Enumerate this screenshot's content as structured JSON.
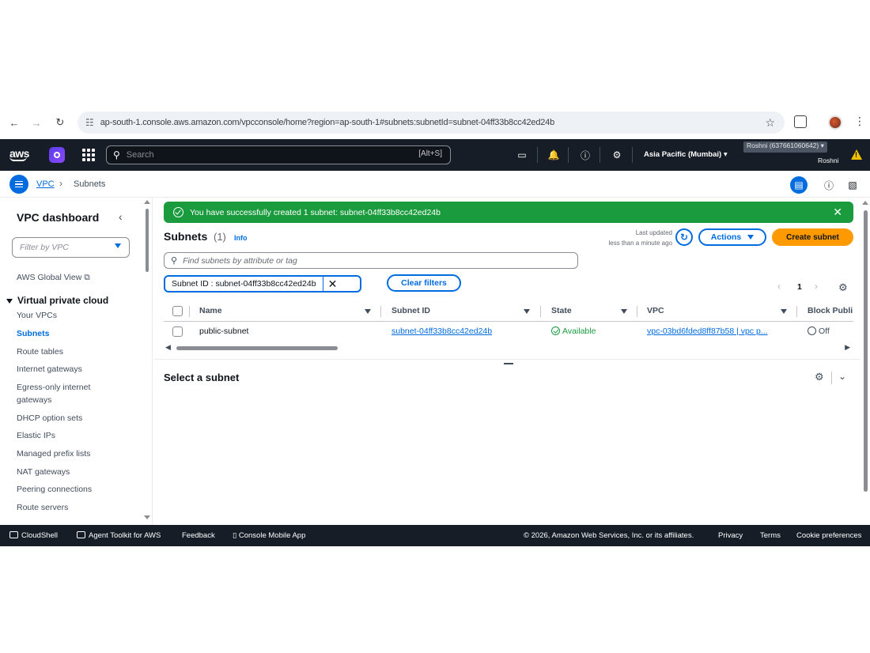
{
  "browser": {
    "url": "ap-south-1.console.aws.amazon.com/vpcconsole/home?region=ap-south-1#subnets:subnetId=subnet-04ff33b8cc42ed24b"
  },
  "topnav": {
    "logo": "aws",
    "search_placeholder": "Search",
    "search_shortcut": "[Alt+S]",
    "region": "Asia Pacific (Mumbai) ▾",
    "account": "Roshni (637661060642) ▾",
    "user": "Roshni"
  },
  "breadcrumb": {
    "vpc": "VPC",
    "current": "Subnets"
  },
  "sidebar": {
    "title": "VPC dashboard",
    "filter_placeholder": "Filter by VPC",
    "global_view": "AWS Global View",
    "section": "Virtual private cloud",
    "items": [
      {
        "label": "Your VPCs"
      },
      {
        "label": "Subnets"
      },
      {
        "label": "Route tables"
      },
      {
        "label": "Internet gateways"
      },
      {
        "label": "Egress-only internet gateways"
      },
      {
        "label": "DHCP option sets"
      },
      {
        "label": "Elastic IPs"
      },
      {
        "label": "Managed prefix lists"
      },
      {
        "label": "NAT gateways"
      },
      {
        "label": "Peering connections"
      },
      {
        "label": "Route servers"
      }
    ]
  },
  "flash": {
    "message": "You have successfully created 1 subnet: subnet-04ff33b8cc42ed24b"
  },
  "subnets": {
    "title": "Subnets",
    "count": "(1)",
    "info": "Info",
    "last_updated_label": "Last updated",
    "last_updated_value": "less than a minute ago",
    "actions_label": "Actions",
    "create_label": "Create subnet",
    "search_placeholder": "Find subnets by attribute or tag",
    "filter_token": "Subnet ID : subnet-04ff33b8cc42ed24b",
    "clear_filters": "Clear filters",
    "page": "1",
    "columns": [
      "Name",
      "Subnet ID",
      "State",
      "VPC",
      "Block Publi"
    ],
    "rows": [
      {
        "name": "public-subnet",
        "subnet_id": "subnet-04ff33b8cc42ed24b",
        "state": "Available",
        "vpc": "vpc-03bd6fded8ff87b58 | vpc p...",
        "block_public": "Off"
      }
    ]
  },
  "details": {
    "title": "Select a subnet"
  },
  "footer": {
    "cloudshell": "CloudShell",
    "toolkit": "Agent Toolkit for AWS",
    "feedback": "Feedback",
    "mobile": "Console Mobile App",
    "copyright": "© 2026, Amazon Web Services, Inc. or its affiliates.",
    "privacy": "Privacy",
    "terms": "Terms",
    "cookies": "Cookie preferences"
  },
  "colors": {
    "nav_bg": "#161d26",
    "link": "#006ce0",
    "success": "#1a9c3e",
    "primary_button": "#ff9900"
  }
}
